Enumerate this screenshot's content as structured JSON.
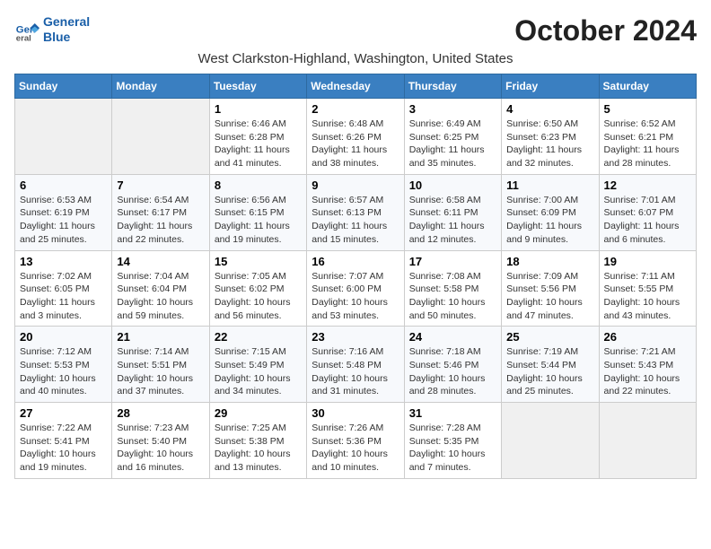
{
  "header": {
    "logo_line1": "General",
    "logo_line2": "Blue",
    "title": "October 2024",
    "subtitle": "West Clarkston-Highland, Washington, United States"
  },
  "days_of_week": [
    "Sunday",
    "Monday",
    "Tuesday",
    "Wednesday",
    "Thursday",
    "Friday",
    "Saturday"
  ],
  "weeks": [
    [
      {
        "day": "",
        "info": ""
      },
      {
        "day": "",
        "info": ""
      },
      {
        "day": "1",
        "info": "Sunrise: 6:46 AM\nSunset: 6:28 PM\nDaylight: 11 hours and 41 minutes."
      },
      {
        "day": "2",
        "info": "Sunrise: 6:48 AM\nSunset: 6:26 PM\nDaylight: 11 hours and 38 minutes."
      },
      {
        "day": "3",
        "info": "Sunrise: 6:49 AM\nSunset: 6:25 PM\nDaylight: 11 hours and 35 minutes."
      },
      {
        "day": "4",
        "info": "Sunrise: 6:50 AM\nSunset: 6:23 PM\nDaylight: 11 hours and 32 minutes."
      },
      {
        "day": "5",
        "info": "Sunrise: 6:52 AM\nSunset: 6:21 PM\nDaylight: 11 hours and 28 minutes."
      }
    ],
    [
      {
        "day": "6",
        "info": "Sunrise: 6:53 AM\nSunset: 6:19 PM\nDaylight: 11 hours and 25 minutes."
      },
      {
        "day": "7",
        "info": "Sunrise: 6:54 AM\nSunset: 6:17 PM\nDaylight: 11 hours and 22 minutes."
      },
      {
        "day": "8",
        "info": "Sunrise: 6:56 AM\nSunset: 6:15 PM\nDaylight: 11 hours and 19 minutes."
      },
      {
        "day": "9",
        "info": "Sunrise: 6:57 AM\nSunset: 6:13 PM\nDaylight: 11 hours and 15 minutes."
      },
      {
        "day": "10",
        "info": "Sunrise: 6:58 AM\nSunset: 6:11 PM\nDaylight: 11 hours and 12 minutes."
      },
      {
        "day": "11",
        "info": "Sunrise: 7:00 AM\nSunset: 6:09 PM\nDaylight: 11 hours and 9 minutes."
      },
      {
        "day": "12",
        "info": "Sunrise: 7:01 AM\nSunset: 6:07 PM\nDaylight: 11 hours and 6 minutes."
      }
    ],
    [
      {
        "day": "13",
        "info": "Sunrise: 7:02 AM\nSunset: 6:05 PM\nDaylight: 11 hours and 3 minutes."
      },
      {
        "day": "14",
        "info": "Sunrise: 7:04 AM\nSunset: 6:04 PM\nDaylight: 10 hours and 59 minutes."
      },
      {
        "day": "15",
        "info": "Sunrise: 7:05 AM\nSunset: 6:02 PM\nDaylight: 10 hours and 56 minutes."
      },
      {
        "day": "16",
        "info": "Sunrise: 7:07 AM\nSunset: 6:00 PM\nDaylight: 10 hours and 53 minutes."
      },
      {
        "day": "17",
        "info": "Sunrise: 7:08 AM\nSunset: 5:58 PM\nDaylight: 10 hours and 50 minutes."
      },
      {
        "day": "18",
        "info": "Sunrise: 7:09 AM\nSunset: 5:56 PM\nDaylight: 10 hours and 47 minutes."
      },
      {
        "day": "19",
        "info": "Sunrise: 7:11 AM\nSunset: 5:55 PM\nDaylight: 10 hours and 43 minutes."
      }
    ],
    [
      {
        "day": "20",
        "info": "Sunrise: 7:12 AM\nSunset: 5:53 PM\nDaylight: 10 hours and 40 minutes."
      },
      {
        "day": "21",
        "info": "Sunrise: 7:14 AM\nSunset: 5:51 PM\nDaylight: 10 hours and 37 minutes."
      },
      {
        "day": "22",
        "info": "Sunrise: 7:15 AM\nSunset: 5:49 PM\nDaylight: 10 hours and 34 minutes."
      },
      {
        "day": "23",
        "info": "Sunrise: 7:16 AM\nSunset: 5:48 PM\nDaylight: 10 hours and 31 minutes."
      },
      {
        "day": "24",
        "info": "Sunrise: 7:18 AM\nSunset: 5:46 PM\nDaylight: 10 hours and 28 minutes."
      },
      {
        "day": "25",
        "info": "Sunrise: 7:19 AM\nSunset: 5:44 PM\nDaylight: 10 hours and 25 minutes."
      },
      {
        "day": "26",
        "info": "Sunrise: 7:21 AM\nSunset: 5:43 PM\nDaylight: 10 hours and 22 minutes."
      }
    ],
    [
      {
        "day": "27",
        "info": "Sunrise: 7:22 AM\nSunset: 5:41 PM\nDaylight: 10 hours and 19 minutes."
      },
      {
        "day": "28",
        "info": "Sunrise: 7:23 AM\nSunset: 5:40 PM\nDaylight: 10 hours and 16 minutes."
      },
      {
        "day": "29",
        "info": "Sunrise: 7:25 AM\nSunset: 5:38 PM\nDaylight: 10 hours and 13 minutes."
      },
      {
        "day": "30",
        "info": "Sunrise: 7:26 AM\nSunset: 5:36 PM\nDaylight: 10 hours and 10 minutes."
      },
      {
        "day": "31",
        "info": "Sunrise: 7:28 AM\nSunset: 5:35 PM\nDaylight: 10 hours and 7 minutes."
      },
      {
        "day": "",
        "info": ""
      },
      {
        "day": "",
        "info": ""
      }
    ]
  ]
}
